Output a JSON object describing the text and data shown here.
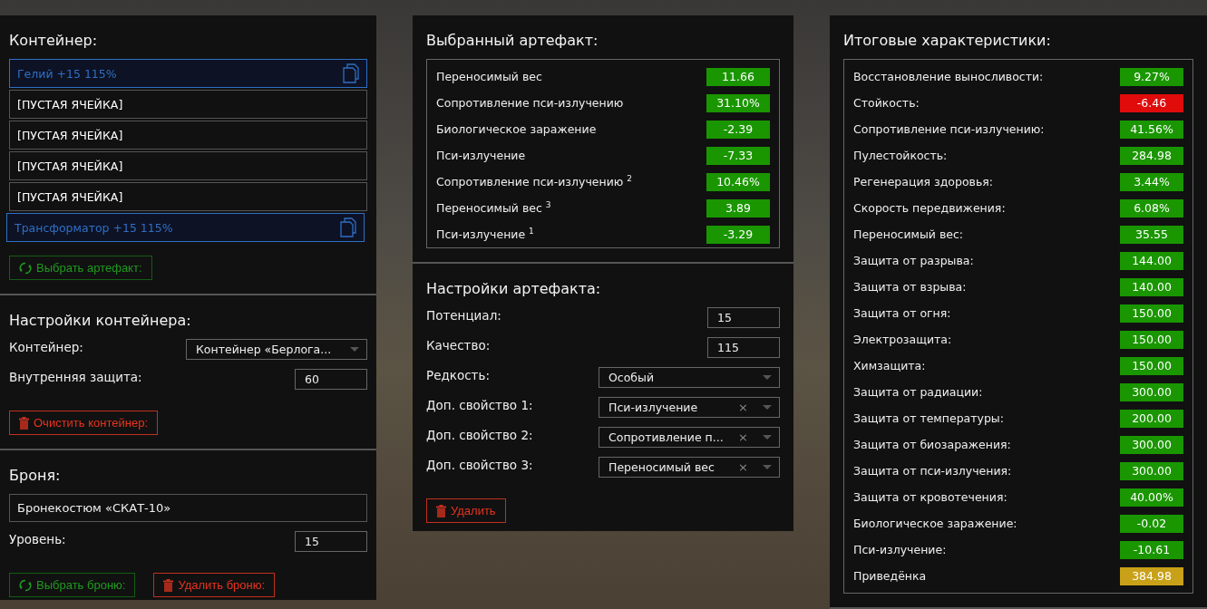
{
  "container_panel": {
    "title": "Контейнер:",
    "slots": [
      {
        "kind": "artifact",
        "label": "Гелий +15 115%"
      },
      {
        "kind": "empty",
        "label": "[ПУСТАЯ ЯЧЕЙКА]"
      },
      {
        "kind": "empty",
        "label": "[ПУСТАЯ ЯЧЕЙКА]"
      },
      {
        "kind": "empty",
        "label": "[ПУСТАЯ ЯЧЕЙКА]"
      },
      {
        "kind": "empty",
        "label": "[ПУСТАЯ ЯЧЕЙКА]"
      },
      {
        "kind": "artifact",
        "label": "Трансформатор +15 115%"
      }
    ],
    "select_button": "Выбрать артефакт:"
  },
  "container_settings": {
    "title": "Настройки контейнера:",
    "fields": [
      {
        "kind": "select",
        "label": "Контейнер:",
        "value": "Контейнер «Берлога..."
      },
      {
        "kind": "input",
        "label": "Внутренняя защита:",
        "value": "60"
      }
    ],
    "clear_button": "Очистить контейнер:"
  },
  "armor": {
    "title": "Броня:",
    "name": "Бронекостюм «СКАТ-10»",
    "fields": [
      {
        "kind": "input",
        "label": "Уровень:",
        "value": "15"
      }
    ],
    "select_button": "Выбрать броню:",
    "delete_button": "Удалить броню:"
  },
  "selected_artifact": {
    "title": "Выбранный артефакт:",
    "stats": [
      {
        "name": "Переносимый вес",
        "value": "11.66",
        "color": "#1a9600"
      },
      {
        "name": "Сопротивление пси-излучению",
        "value": "31.10%",
        "color": "#1a9600"
      },
      {
        "name": "Биологическое заражение",
        "value": "-2.39",
        "color": "#1a9600"
      },
      {
        "name": "Пси-излучение",
        "value": "-7.33",
        "color": "#1a9600"
      },
      {
        "name": "Сопротивление пси-излучению $^{2}$",
        "value": "10.46%",
        "color": "#1a9600"
      },
      {
        "name": "Переносимый вес $^{3}$",
        "value": "3.89",
        "color": "#1a9600"
      },
      {
        "name": "Пси-излучение $^{1}$",
        "value": "-3.29",
        "color": "#1a9600"
      }
    ]
  },
  "artifact_settings": {
    "title": "Настройки артефакта:",
    "fields": [
      {
        "kind": "input",
        "label": "Потенциал:",
        "value": "15"
      },
      {
        "kind": "input",
        "label": "Качество:",
        "value": "115"
      },
      {
        "kind": "select",
        "label": "Редкость:",
        "value": "Особый"
      },
      {
        "kind": "select",
        "label": "Доп. свойство 1:",
        "value": "Пси-излучение",
        "clear": "×"
      },
      {
        "kind": "select",
        "label": "Доп. свойство 2:",
        "value": "Сопротивление п...",
        "clear": "×"
      },
      {
        "kind": "select",
        "label": "Доп. свойство 3:",
        "value": "Переносимый вес",
        "clear": "×"
      }
    ],
    "delete_button": "Удалить"
  },
  "totals": {
    "title": "Итоговые характеристики:",
    "stats": [
      {
        "name": "Восстановление выносливости:",
        "value": "9.27%",
        "color": "#1a9600"
      },
      {
        "name": "Стойкость:",
        "value": "-6.46",
        "color": "#e00b0b"
      },
      {
        "name": "Сопротивление пси-излучению:",
        "value": "41.56%",
        "color": "#1a9600"
      },
      {
        "name": "Пулестойкость:",
        "value": "284.98",
        "color": "#1a9600"
      },
      {
        "name": "Регенерация здоровья:",
        "value": "3.44%",
        "color": "#1a9600"
      },
      {
        "name": "Скорость передвижения:",
        "value": "6.08%",
        "color": "#1a9600"
      },
      {
        "name": "Переносимый вес:",
        "value": "35.55",
        "color": "#1a9600"
      },
      {
        "name": "Защита от разрыва:",
        "value": "144.00",
        "color": "#1a9600"
      },
      {
        "name": "Защита от взрыва:",
        "value": "140.00",
        "color": "#1a9600"
      },
      {
        "name": "Защита от огня:",
        "value": "150.00",
        "color": "#1a9600"
      },
      {
        "name": "Электрозащита:",
        "value": "150.00",
        "color": "#1a9600"
      },
      {
        "name": "Химзащита:",
        "value": "150.00",
        "color": "#1a9600"
      },
      {
        "name": "Защита от радиации:",
        "value": "300.00",
        "color": "#1a9600"
      },
      {
        "name": "Защита от температуры:",
        "value": "200.00",
        "color": "#1a9600"
      },
      {
        "name": "Защита от биозаражения:",
        "value": "300.00",
        "color": "#1a9600"
      },
      {
        "name": "Защита от пси-излучения:",
        "value": "300.00",
        "color": "#1a9600"
      },
      {
        "name": "Защита от кровотечения:",
        "value": "40.00%",
        "color": "#1a9600"
      },
      {
        "name": "Биологическое заражение:",
        "value": "-0.02",
        "color": "#1a9600"
      },
      {
        "name": "Пси-излучение:",
        "value": "-10.61",
        "color": "#1a9600"
      },
      {
        "name": "Приведёнка",
        "value": "384.98",
        "color": "#c9a118"
      }
    ]
  }
}
